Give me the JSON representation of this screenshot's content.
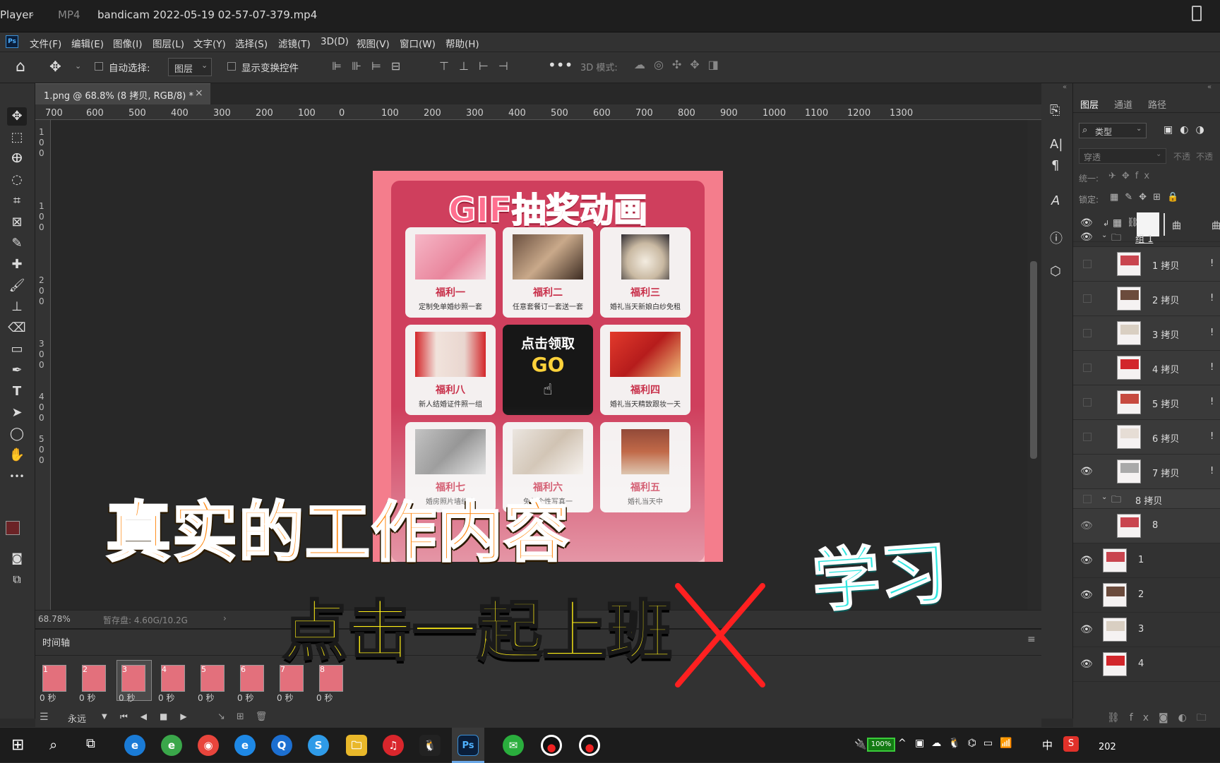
{
  "player": {
    "app": "Player",
    "format": "MP4",
    "filename": "bandicam 2022-05-19 02-57-07-379.mp4"
  },
  "menu": [
    "文件(F)",
    "编辑(E)",
    "图像(I)",
    "图层(L)",
    "文字(Y)",
    "选择(S)",
    "滤镜(T)",
    "3D(D)",
    "视图(V)",
    "窗口(W)",
    "帮助(H)"
  ],
  "options": {
    "auto_select_label": "自动选择:",
    "auto_select_value": "图层",
    "show_transform": "显示变换控件",
    "mode_3d": "3D 模式:"
  },
  "document": {
    "tab_title": "1.png @ 68.8% (8 拷贝, RGB/8) *",
    "close": "×"
  },
  "ruler_top": [
    "700",
    "600",
    "500",
    "400",
    "300",
    "200",
    "100",
    "0",
    "100",
    "200",
    "300",
    "400",
    "500",
    "600",
    "700",
    "800",
    "900",
    "1000",
    "1100",
    "1200",
    "1300"
  ],
  "ruler_left": [
    "1",
    "0",
    "0",
    "1",
    "0",
    "0",
    "2",
    "0",
    "0",
    "3",
    "0",
    "0",
    "4",
    "0",
    "0",
    "5",
    "0",
    "0",
    "6",
    "0",
    "0",
    "7",
    "0",
    "0",
    "8",
    "0",
    "0",
    "9",
    "0",
    "0"
  ],
  "status": {
    "zoom": "68.78%",
    "scratch": "暂存盘: 4.60G/10.2G"
  },
  "timeline": {
    "title": "时间轴",
    "loop": "永远",
    "frames": [
      {
        "num": "1",
        "time": "0 秒"
      },
      {
        "num": "2",
        "time": "0 秒"
      },
      {
        "num": "3",
        "time": "0 秒"
      },
      {
        "num": "4",
        "time": "0 秒"
      },
      {
        "num": "5",
        "time": "0 秒"
      },
      {
        "num": "6",
        "time": "0 秒"
      },
      {
        "num": "7",
        "time": "0 秒"
      },
      {
        "num": "8",
        "time": "0 秒"
      }
    ]
  },
  "poster": {
    "title": "GIF抽奖动画",
    "cards": [
      {
        "title": "福利一",
        "sub": "定制免单婚纱照一套"
      },
      {
        "title": "福利二",
        "sub": "任意套餐订一套送一套"
      },
      {
        "title": "福利三",
        "sub": "婚礼当天新娘白纱免租"
      },
      {
        "title": "福利八",
        "sub": "新人结婚证件照一组"
      },
      {
        "title": "福利四",
        "sub": "婚礼当天精致跟妆一天"
      },
      {
        "title": "福利七",
        "sub": "婚房照片墙组合"
      },
      {
        "title": "福利六",
        "sub": "免单个性写真一"
      },
      {
        "title": "福利五",
        "sub": "婚礼当天中"
      }
    ],
    "center": {
      "line1": "点击领取",
      "line2": "GO"
    }
  },
  "overlay": {
    "line1": "真实的工作内容",
    "line2": "点击一起上班",
    "side": "学习"
  },
  "layers_panel": {
    "tabs": [
      "图层",
      "通道",
      "路径"
    ],
    "filter": "类型",
    "blend": "穿透",
    "opacity_label": "不透",
    "unify": "统一:",
    "lock": "锁定:",
    "top_label": "曲",
    "group1": "组 1",
    "group_copy": "8 拷贝",
    "items": [
      "1 拷贝",
      "2 拷贝",
      "3 拷贝",
      "4 拷贝",
      "5 拷贝",
      "6 拷贝",
      "7 拷贝"
    ],
    "item8": "8",
    "bottom_items": [
      "1",
      "2",
      "3",
      "4"
    ],
    "excl": "!"
  },
  "taskbar": {
    "battery": "100%",
    "ime": "中",
    "year": "202"
  }
}
